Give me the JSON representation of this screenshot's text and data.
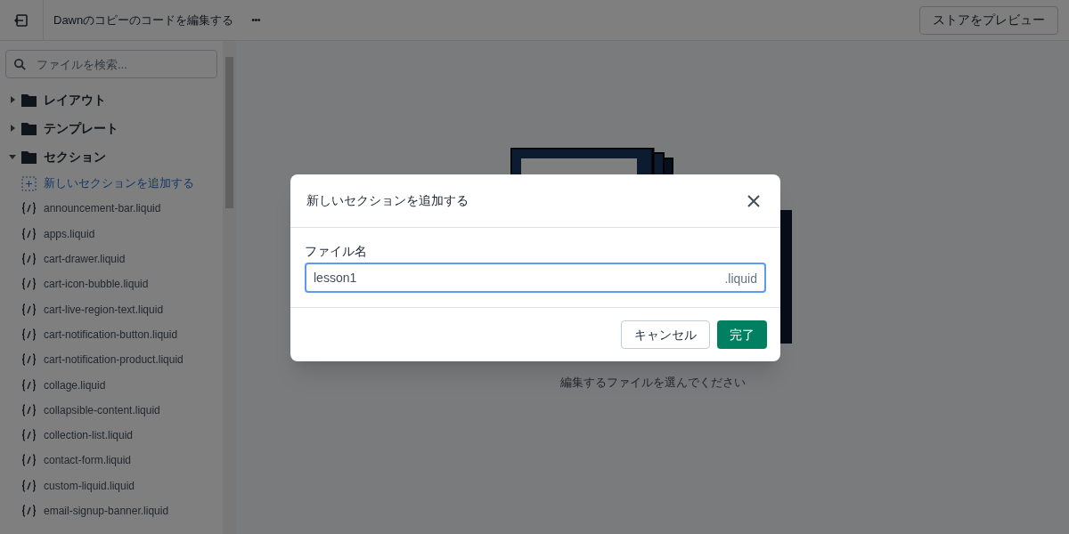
{
  "topbar": {
    "title": "Dawnのコピーのコードを編集する",
    "more": "•••",
    "preview_button": "ストアをプレビュー"
  },
  "sidebar": {
    "search": {
      "placeholder": "ファイルを検索..."
    },
    "folders": [
      {
        "label": "レイアウト",
        "expanded": false
      },
      {
        "label": "テンプレート",
        "expanded": false
      },
      {
        "label": "セクション",
        "expanded": true,
        "children": [
          {
            "kind": "add",
            "label": "新しいセクションを追加する"
          },
          {
            "kind": "file",
            "label": "announcement-bar.liquid"
          },
          {
            "kind": "file",
            "label": "apps.liquid"
          },
          {
            "kind": "file",
            "label": "cart-drawer.liquid"
          },
          {
            "kind": "file",
            "label": "cart-icon-bubble.liquid"
          },
          {
            "kind": "file",
            "label": "cart-live-region-text.liquid"
          },
          {
            "kind": "file",
            "label": "cart-notification-button.liquid"
          },
          {
            "kind": "file",
            "label": "cart-notification-product.liquid"
          },
          {
            "kind": "file",
            "label": "collage.liquid"
          },
          {
            "kind": "file",
            "label": "collapsible-content.liquid"
          },
          {
            "kind": "file",
            "label": "collection-list.liquid"
          },
          {
            "kind": "file",
            "label": "contact-form.liquid"
          },
          {
            "kind": "file",
            "label": "custom-liquid.liquid"
          },
          {
            "kind": "file",
            "label": "email-signup-banner.liquid"
          }
        ]
      }
    ]
  },
  "main": {
    "subtitle": "編集するファイルを選んでください"
  },
  "modal": {
    "title": "新しいセクションを追加する",
    "field_label": "ファイル名",
    "field_value": "lesson1",
    "suffix": ".liquid",
    "cancel": "キャンセル",
    "confirm": "完了"
  }
}
